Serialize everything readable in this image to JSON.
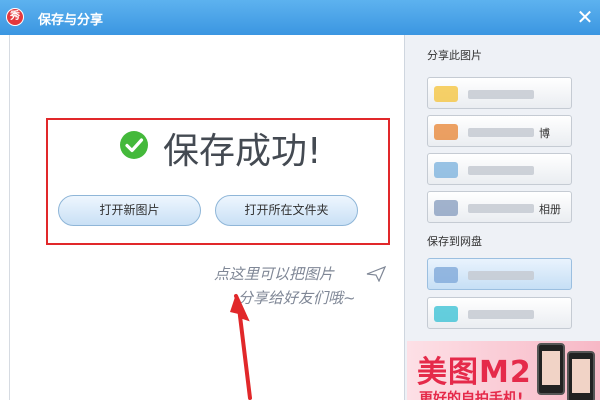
{
  "window": {
    "title": "保存与分享",
    "logo_text": "秀",
    "close_glyph": "✕"
  },
  "main": {
    "success_message": "保存成功!",
    "buttons": {
      "open_new_image": "打开新图片",
      "open_folder": "打开所在文件夹"
    },
    "hint_line_1": "点这里可以把图片",
    "hint_line_2": "分享给好友们哦~"
  },
  "share_panel": {
    "share_section_title": "分享此图片",
    "share_items": [
      {
        "label": "",
        "icon": "blurred-icon",
        "icon_color": "#f5c542"
      },
      {
        "label": "博",
        "icon": "blurred-icon",
        "icon_color": "#e98a3c"
      },
      {
        "label": "",
        "icon": "blurred-icon",
        "icon_color": "#7fb4de"
      },
      {
        "label": "相册",
        "icon": "blurred-icon",
        "icon_color": "#8ba0c0"
      }
    ],
    "cloud_section_title": "保存到网盘",
    "cloud_items": [
      {
        "label": "",
        "icon": "blurred-icon",
        "icon_color": "#7fa9d9"
      },
      {
        "label": "",
        "icon": "blurred-icon",
        "icon_color": "#3fc3d6"
      }
    ]
  },
  "ad": {
    "title": "美图M2",
    "subtitle": "更好的自拍手机!"
  },
  "colors": {
    "titlebar": "#3b96e1",
    "highlight_box": "#e1282a",
    "check": "#44b93b",
    "arrow": "#e1282a"
  }
}
